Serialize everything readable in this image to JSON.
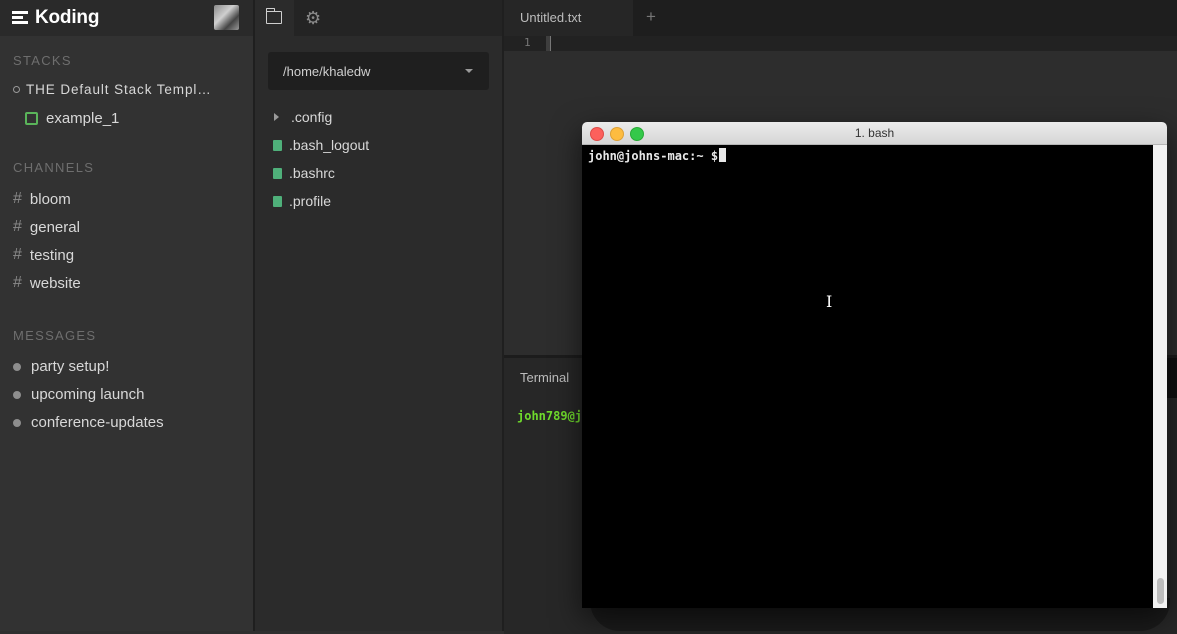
{
  "sidebar": {
    "logo": "Koding",
    "stacks_title": "STACKS",
    "stack_name": "THE Default Stack Templ…",
    "machine_name": "example_1",
    "channels_title": "CHANNELS",
    "channels": [
      "bloom",
      "general",
      "testing",
      "website"
    ],
    "messages_title": "MESSAGES",
    "messages": [
      "party setup!",
      "upcoming launch",
      "conference-updates"
    ],
    "hash": "#"
  },
  "files": {
    "path": "/home/khaledw",
    "items": [
      ".config",
      ".bash_logout",
      ".bashrc",
      ".profile"
    ]
  },
  "editor": {
    "tab": "Untitled.txt",
    "plus": "+",
    "line_number": "1"
  },
  "terminal_pane": {
    "tab": "Terminal",
    "prompt": "john789@jo"
  },
  "mac_terminal": {
    "title": "1. bash",
    "prompt": "john@johns-mac:~ $"
  },
  "colors": {
    "close": "#fc605c",
    "minimize": "#fdbc40",
    "zoom": "#34c84a",
    "machine": "#5ab45a",
    "file_icon": "#4fb07a",
    "prompt_green": "#6fdc2c"
  }
}
